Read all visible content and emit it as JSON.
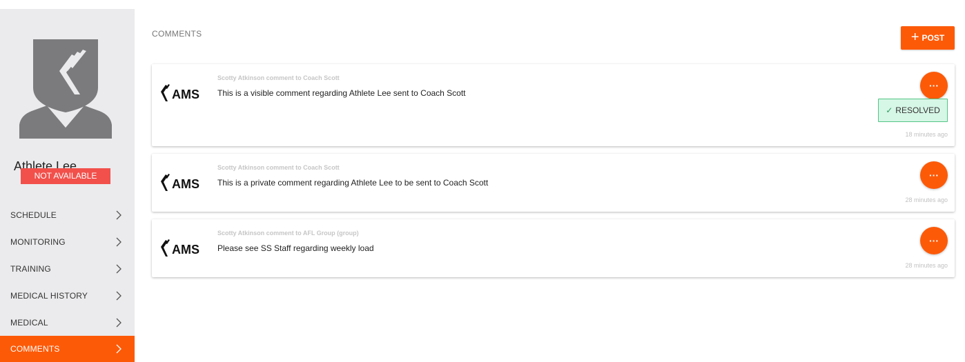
{
  "athlete": {
    "name": "Athlete Lee",
    "status": "NOT AVAILABLE"
  },
  "nav": {
    "items": [
      {
        "label": "SCHEDULE",
        "active": false
      },
      {
        "label": "MONITORING",
        "active": false
      },
      {
        "label": "TRAINING",
        "active": false
      },
      {
        "label": "MEDICAL HISTORY",
        "active": false
      },
      {
        "label": "MEDICAL",
        "active": false
      },
      {
        "label": "COMMENTS",
        "active": true
      }
    ]
  },
  "main": {
    "title": "COMMENTS",
    "post_label": "POST"
  },
  "comments": [
    {
      "meta": "Scotty Atkinson comment to Coach Scott",
      "text": "This is a visible comment regarding Athlete Lee sent to Coach Scott",
      "more_label": "···",
      "resolved_label": "RESOLVED",
      "time": "18 minutes ago",
      "logo_text": "AMS"
    },
    {
      "meta": "Scotty Atkinson comment to Coach Scott",
      "text": "This is a private comment regarding Athlete Lee to be sent to Coach Scott",
      "more_label": "···",
      "time": "28 minutes ago",
      "logo_text": "AMS"
    },
    {
      "meta": "Scotty Atkinson comment to AFL Group (group)",
      "text": "Please see SS Staff regarding weekly load",
      "more_label": "···",
      "time": "28 minutes ago",
      "logo_text": "AMS"
    }
  ],
  "colors": {
    "accent": "#fd5a08",
    "sidebar_bg": "#ebebed",
    "status_red": "#f2504b",
    "resolved_bg": "#d6f6e6",
    "resolved_border": "#52c585"
  }
}
